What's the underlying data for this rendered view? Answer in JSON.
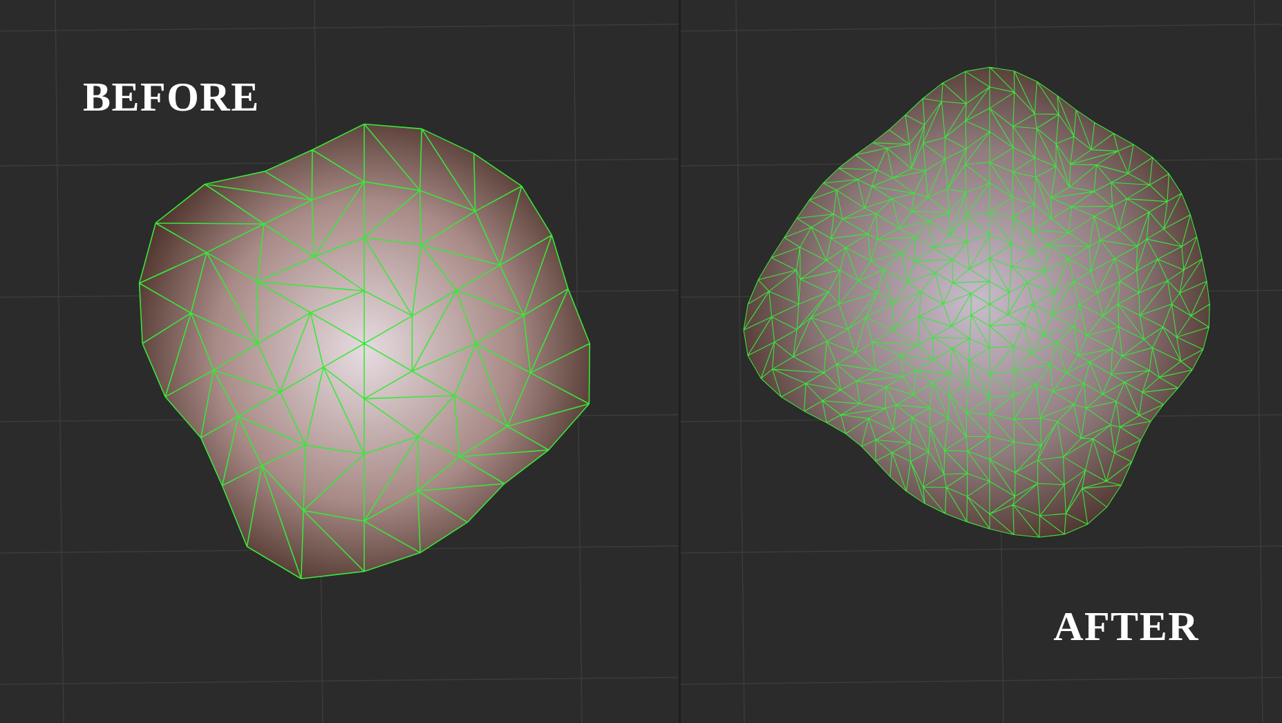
{
  "panels": [
    {
      "label": "BEFORE",
      "kind": "coarse"
    },
    {
      "label": "AFTER",
      "kind": "dense"
    }
  ]
}
